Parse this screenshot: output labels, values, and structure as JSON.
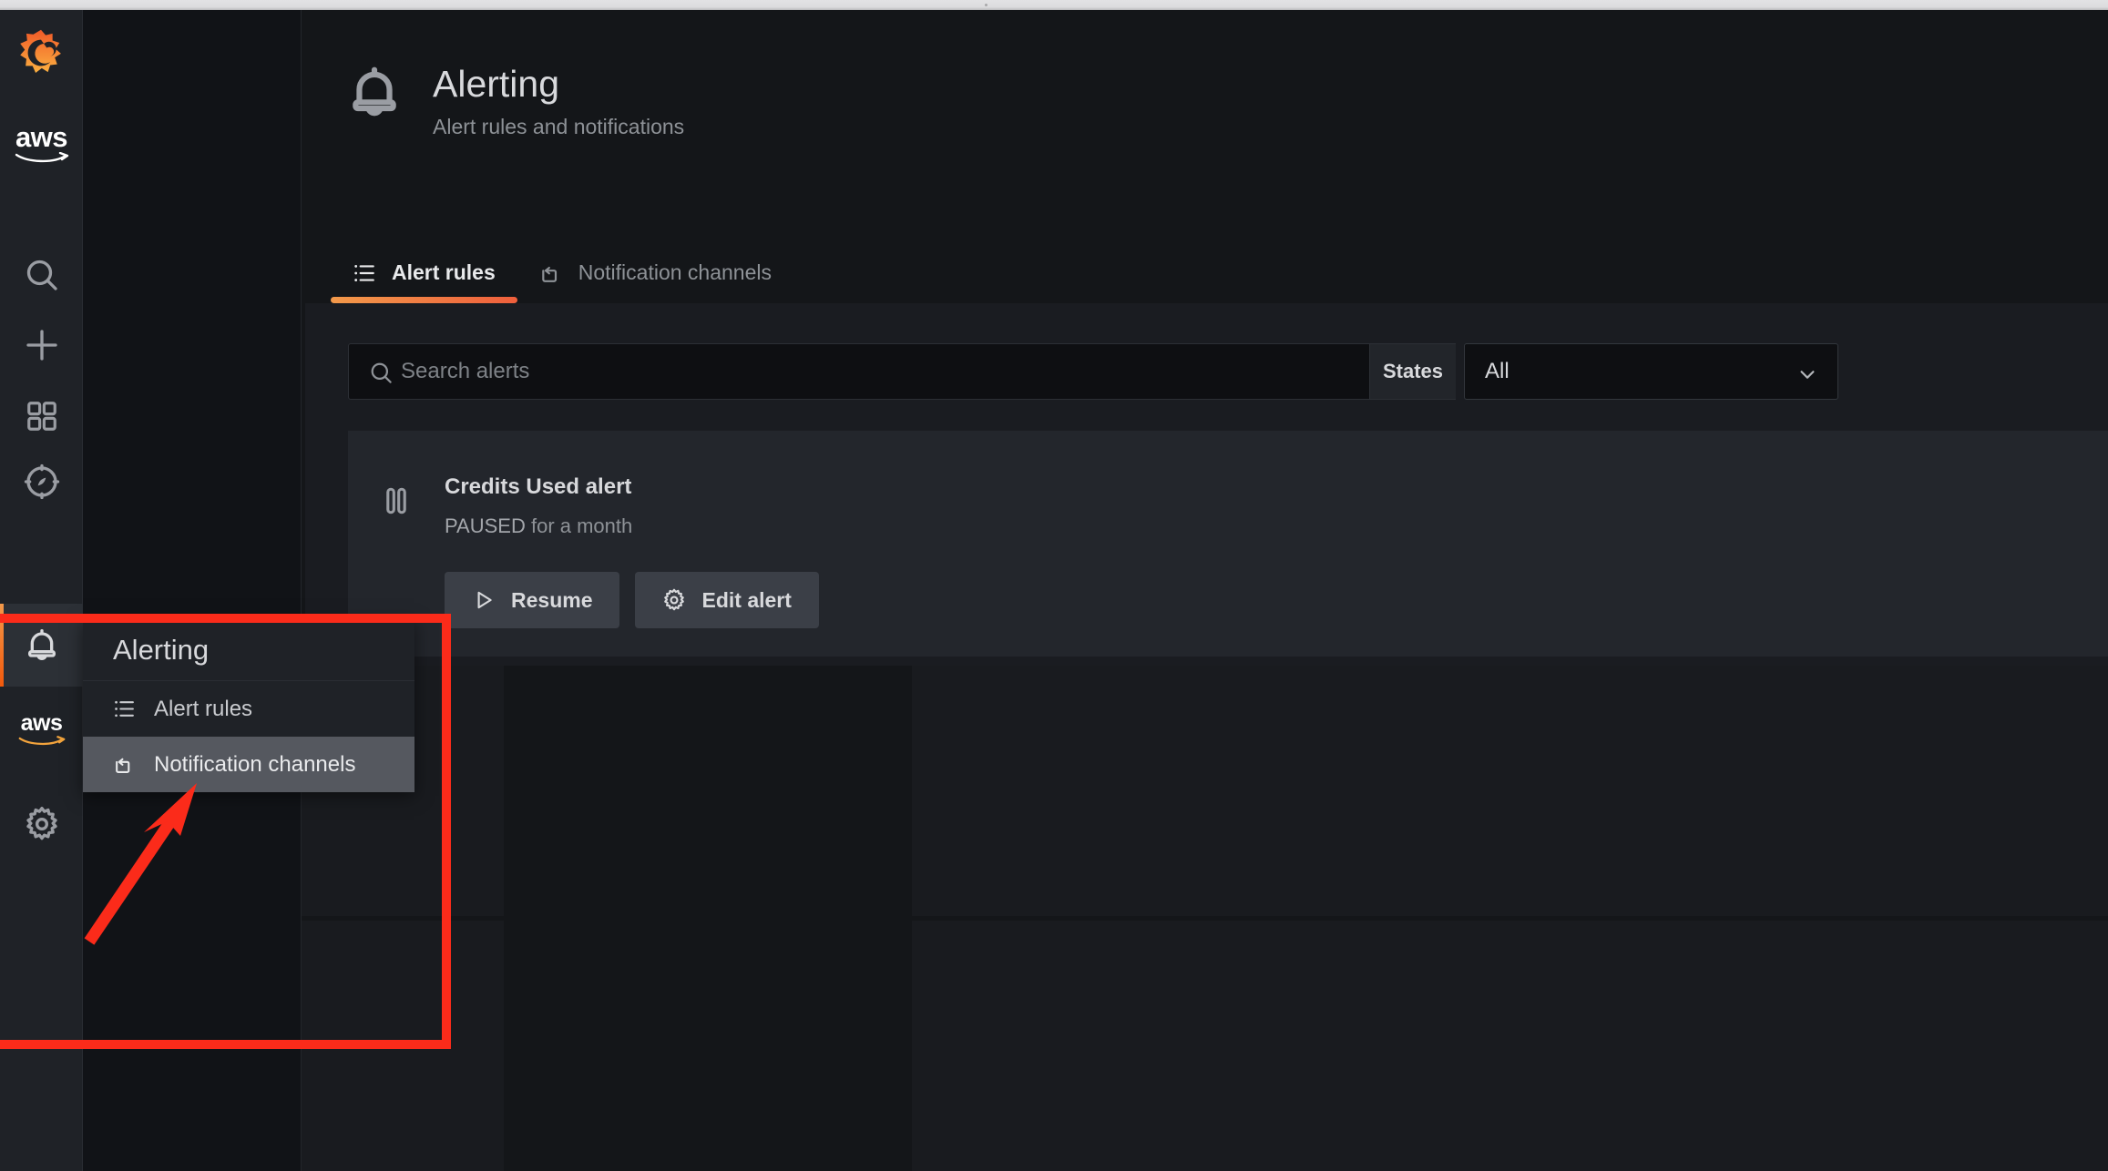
{
  "window": {
    "chrome_color": "#dcdcde"
  },
  "theme": {
    "accent_orange_start": "#f2994a",
    "accent_orange_end": "#f2590c",
    "page_bg": "#141619",
    "panel_bg": "#1a1c21",
    "card_bg": "#23262c",
    "text_primary": "#d8d9dc",
    "text_secondary": "#8e9297",
    "annotation_red": "#fb2b1a"
  },
  "rail": {
    "logo_name": "grafana-logo",
    "org_logo_text": "aws",
    "items": [
      {
        "name": "search-icon",
        "label": "Search"
      },
      {
        "name": "plus-icon",
        "label": "Create"
      },
      {
        "name": "dashboards-icon",
        "label": "Dashboards"
      },
      {
        "name": "explore-compass-icon",
        "label": "Explore"
      },
      {
        "name": "bell-icon",
        "label": "Alerting",
        "active": true
      },
      {
        "name": "gear-icon",
        "label": "Configuration"
      }
    ]
  },
  "header": {
    "icon": "bell-icon",
    "title": "Alerting",
    "subtitle": "Alert rules and notifications"
  },
  "tabs": [
    {
      "icon": "list-icon",
      "label": "Alert rules",
      "active": true
    },
    {
      "icon": "comment-share-icon",
      "label": "Notification channels",
      "active": false
    }
  ],
  "search": {
    "icon": "search-icon",
    "placeholder": "Search alerts",
    "value": "",
    "states_label": "States",
    "states_selected": "All",
    "states_chevron": "chevron-down-icon"
  },
  "alerts": [
    {
      "state_icon": "pause-icon",
      "name": "Credits Used alert",
      "state": "PAUSED",
      "state_detail": "for a month",
      "status_text": "PAUSED for a month",
      "actions": [
        {
          "icon": "play-icon",
          "label": "Resume"
        },
        {
          "icon": "gear-icon",
          "label": "Edit alert"
        }
      ]
    }
  ],
  "flyout": {
    "header": "Alerting",
    "items": [
      {
        "icon": "list-icon",
        "label": "Alert rules",
        "hovered": false
      },
      {
        "icon": "comment-share-icon",
        "label": "Notification channels",
        "hovered": true
      }
    ]
  },
  "annotations": {
    "highlight_box": "red-rectangle-around-alerting-flyout",
    "arrow": "red-arrow-pointing-to-notification-channels"
  }
}
